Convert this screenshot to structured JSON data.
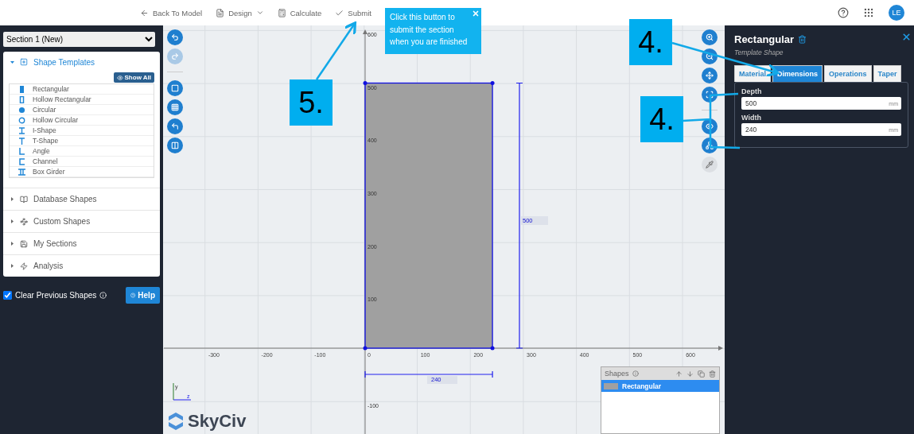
{
  "topbar": {
    "nav": [
      {
        "label": "Back To Model",
        "kind": "back"
      },
      {
        "label": "Design",
        "kind": "design"
      },
      {
        "label": "Calculate",
        "kind": "calculate"
      },
      {
        "label": "Submit",
        "kind": "submit"
      }
    ],
    "avatar": "LE"
  },
  "sidebar": {
    "section_select": "Section 1 (New)",
    "show_all": "Show All",
    "groups": [
      {
        "title": "Shape Templates",
        "kind": "templates",
        "expanded": true
      },
      {
        "title": "Database Shapes",
        "kind": "database",
        "expanded": false
      },
      {
        "title": "Custom Shapes",
        "kind": "custom",
        "expanded": false
      },
      {
        "title": "My Sections",
        "kind": "sections",
        "expanded": false
      },
      {
        "title": "Analysis",
        "kind": "analysis",
        "expanded": false
      }
    ],
    "templates": [
      {
        "label": "Rectangular",
        "kind": "rect"
      },
      {
        "label": "Hollow Rectangular",
        "kind": "hollow-rect"
      },
      {
        "label": "Circular",
        "kind": "circle"
      },
      {
        "label": "Hollow Circular",
        "kind": "hollow-circle"
      },
      {
        "label": "I-Shape",
        "kind": "i"
      },
      {
        "label": "T-Shape",
        "kind": "t"
      },
      {
        "label": "Angle",
        "kind": "angle"
      },
      {
        "label": "Channel",
        "kind": "channel"
      },
      {
        "label": "Box Girder",
        "kind": "box-girder"
      }
    ],
    "clear_previous": {
      "label": "Clear Previous Shapes",
      "checked": true
    },
    "help": "Help"
  },
  "canvas": {
    "left_tools": [
      [
        {
          "kind": "undo",
          "disabled": false
        },
        {
          "kind": "redo",
          "disabled": true
        }
      ],
      [
        {
          "kind": "rect",
          "disabled": false
        },
        {
          "kind": "grid",
          "disabled": false
        },
        {
          "kind": "corner",
          "disabled": false
        },
        {
          "kind": "split",
          "disabled": false
        }
      ]
    ],
    "right_tools": [
      [
        {
          "kind": "zoom-in",
          "disabled": false
        },
        {
          "kind": "zoom-out",
          "disabled": false
        },
        {
          "kind": "move",
          "disabled": false
        },
        {
          "kind": "fit",
          "disabled": false
        }
      ],
      [
        {
          "kind": "eye",
          "disabled": false
        },
        {
          "kind": "network",
          "disabled": false
        },
        {
          "kind": "pipette",
          "disabled": true
        }
      ]
    ],
    "x_ticks": [
      "-300",
      "-200",
      "-100",
      "0",
      "100",
      "200",
      "300",
      "400",
      "500",
      "600"
    ],
    "y_ticks": [
      "600",
      "500",
      "400",
      "300",
      "200",
      "100",
      "-100"
    ],
    "depth_label": "500",
    "width_label": "240",
    "axis_labels": [
      "y",
      "z"
    ],
    "logo": "SkyCiv",
    "shapes_panel": {
      "title": "Shapes",
      "rows": [
        {
          "label": "Rectangular",
          "selected": true
        }
      ]
    }
  },
  "properties": {
    "title": "Rectangular",
    "subtitle": "Template Shape",
    "tabs": [
      {
        "label": "Material",
        "selected": false
      },
      {
        "label": "Dimensions",
        "selected": true
      },
      {
        "label": "Operations",
        "selected": false
      },
      {
        "label": "Taper",
        "selected": false
      }
    ],
    "fields": [
      {
        "label": "Depth",
        "value": "500",
        "unit": "mm"
      },
      {
        "label": "Width",
        "value": "240",
        "unit": "mm"
      }
    ]
  },
  "annotations": [
    {
      "label": "5."
    },
    {
      "label": "4."
    },
    {
      "label": "4."
    }
  ],
  "tooltip": {
    "text": "Click this button to submit the section when you are finished"
  }
}
